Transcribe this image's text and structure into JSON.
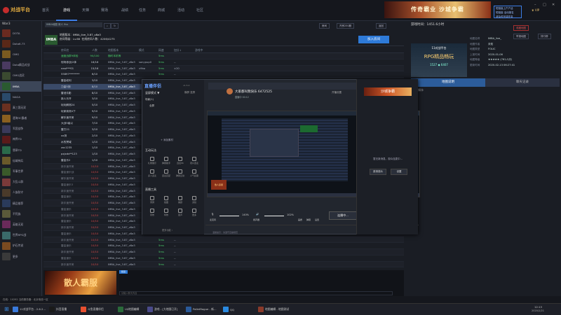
{
  "topnav": {
    "logo": "对战平台",
    "items": [
      "首页",
      "游戏",
      "天梯",
      "赛场",
      "战绩",
      "任务",
      "商城",
      "活动",
      "社区"
    ],
    "active_index": 1,
    "banner_text": "传奇霸业 沙城争霸",
    "notice_lines": [
      "短链接上户户活",
      "短链接 活动报名",
      "请及时完成任务"
    ],
    "vip_label": "VIP"
  },
  "leftbar": {
    "title": "War3",
    "items": [
      {
        "label": "DOTA",
        "color": "#6a2a20"
      },
      {
        "label": "Dota6.73",
        "color": "#5a2818"
      },
      {
        "label": "OMG",
        "color": "#7a5a20"
      },
      {
        "label": "Dota精品对战",
        "color": "#4a3a60"
      },
      {
        "label": "OMG战灵",
        "color": "#3a4a30"
      },
      {
        "label": "IMBA",
        "color": "#2a5a30"
      },
      {
        "label": "NAGA",
        "color": "#2a4a6a"
      },
      {
        "label": "真三国无双",
        "color": "#6a3020"
      },
      {
        "label": "澄海3C霸者",
        "color": "#8a6020"
      },
      {
        "label": "军团战争",
        "color": "#3a3a5a"
      },
      {
        "label": "神界TD",
        "color": "#5a1a1a"
      },
      {
        "label": "翡翠TD",
        "color": "#2a6a4a"
      },
      {
        "label": "仙域神兵",
        "color": "#6a5a2a"
      },
      {
        "label": "军事世界",
        "color": "#3a5a2a"
      },
      {
        "label": "大乱斗群",
        "color": "#7a3a3a"
      },
      {
        "label": "人族防守",
        "color": "#4a3a2a"
      },
      {
        "label": "精品推荐",
        "color": "#2a3a5a"
      },
      {
        "label": "不死族",
        "color": "#5a5a3a"
      },
      {
        "label": "英雄无双",
        "color": "#6a2a5a"
      },
      {
        "label": "世界RPG战",
        "color": "#3a6a6a"
      },
      {
        "label": "炉石传说",
        "color": "#7a4a20"
      },
      {
        "label": "更多",
        "color": "#3a3a3a"
      }
    ],
    "selected_index": 5
  },
  "roomhead": {
    "search_text": "IMBA地图  房人 9vs",
    "badge": "IMBA",
    "map_label": "地图版本：",
    "map_value": "IMBA_live_3.87_v8a3",
    "level_label": "房间等级：Lv.68",
    "player_label": "在线房间人数：4206/4275",
    "btn_filter": "房间",
    "btn_create": "开房250服",
    "btn_return": "返回",
    "join_label": "加入房间"
  },
  "table": {
    "headers": [
      "房间名",
      "人数",
      "地图版本",
      "模式",
      "网速",
      "加分↓",
      "游戏中"
    ],
    "rows": [
      [
        "速度战群9体验",
        "90/100",
        "随时本机等",
        "",
        "5ms",
        "",
        ""
      ],
      [
        "现场参战/2体",
        "16/16",
        "IMBA_live_3.87_v8a3",
        "sonypup0",
        "5ms",
        "--",
        ""
      ],
      [
        "neol***01",
        "15/16",
        "IMBA_live_3.87_v8a3",
        "v9bo",
        "5ms",
        "±20",
        ""
      ],
      [
        "55897********",
        "6/10",
        "IMBA_live_3.87_v8a3",
        "",
        "5ms",
        "--",
        ""
      ],
      [
        "雷金权利",
        "3/10",
        "IMBA_live_3.87_v8a3",
        "",
        "5ms",
        "--",
        ""
      ],
      [
        "力量5测",
        "8/10",
        "IMBA_live_3.87_v8a3",
        "",
        "5ms",
        "--",
        ""
      ],
      [
        "雷池玲影",
        "8/10",
        "IMBA_live_3.87_v8a3",
        "",
        "5ms",
        "--",
        ""
      ],
      [
        "新人乐开",
        "3/10",
        "IMBA_live_3.87_v8a3",
        "",
        "5ms",
        "--",
        ""
      ],
      [
        "玩玩解测24",
        "5/10",
        "IMBA_live_3.87_v8a3",
        "",
        "5ms",
        "--",
        ""
      ],
      [
        "玩家我测4下",
        "9/10",
        "IMBA_live_3.87_v8a3",
        "",
        "5ms",
        "--",
        ""
      ],
      [
        "解手速开房",
        "9/10",
        "IMBA_live_3.87_v8a3",
        "",
        "5ms",
        "--",
        ""
      ],
      [
        "大战5级以",
        "7/10",
        "IMBA_live_3.87_v8a3",
        "",
        "5ms",
        "--",
        ""
      ],
      [
        "雷方21",
        "3/10",
        "IMBA_live_3.87_v8a3",
        "",
        "5ms",
        "--",
        ""
      ],
      [
        "xx测",
        "2/10",
        "IMBA_live_3.87_v8a3",
        "",
        "5ms",
        "--",
        ""
      ],
      [
        "水的冥域",
        "1/10",
        "IMBA_live_3.87_v8a3",
        "",
        "5ms",
        "--",
        ""
      ],
      [
        "zxc1235",
        "1/10",
        "IMBA_live_3.87_v8a3",
        "",
        "5ms",
        "--",
        ""
      ],
      [
        "pxjxds**123",
        "1/10",
        "IMBA_live_3.87_v8a3",
        "",
        "5ms",
        "--",
        ""
      ],
      [
        "雷金乐2",
        "1/10",
        "IMBA_live_3.87_v8a3",
        "",
        "5ms",
        "--",
        ""
      ],
      [
        "新手速开房",
        "10/10",
        "IMBA_live_3.87_v8a3",
        "",
        "5ms",
        "--",
        ""
      ],
      [
        "雷金速乐战",
        "10/10",
        "IMBA_live_3.87_v8a3",
        "",
        "5ms",
        "--",
        ""
      ],
      [
        "解手速开房",
        "10/10",
        "IMBA_live_3.87_v8a3",
        "",
        "5ms",
        "--",
        ""
      ],
      [
        "雷金速乐3",
        "10/10",
        "IMBA_live_3.87_v8a3",
        "",
        "5ms",
        "--",
        ""
      ],
      [
        "新手速开房",
        "10/10",
        "IMBA_live_3.87_v8a3",
        "",
        "5ms",
        "--",
        ""
      ],
      [
        "雷金速乐",
        "10/10",
        "IMBA_live_3.87_v8a3",
        "",
        "5ms",
        "--",
        ""
      ],
      [
        "新手速开房",
        "10/10",
        "IMBA_live_3.87_v8a3",
        "",
        "5ms",
        "--",
        ""
      ],
      [
        "雷金速乐",
        "10/10",
        "IMBA_live_3.87_v8a3",
        "",
        "5ms",
        "--",
        ""
      ],
      [
        "新手速开房",
        "10/10",
        "IMBA_live_3.87_v8a3",
        "",
        "5ms",
        "--",
        ""
      ],
      [
        "雷金速乐",
        "10/10",
        "IMBA_live_3.87_v8a3",
        "",
        "5ms",
        "--",
        ""
      ],
      [
        "新手速开房",
        "10/10",
        "IMBA_live_3.87_v8a3",
        "",
        "5ms",
        "--",
        ""
      ],
      [
        "雷金速乐",
        "10/10",
        "IMBA_live_3.87_v8a3",
        "",
        "5ms",
        "--",
        ""
      ],
      [
        "新手速开房",
        "10/10",
        "IMBA_live_3.87_v8a3",
        "",
        "5ms",
        "--",
        ""
      ],
      [
        "雷金速乐",
        "10/10",
        "IMBA_live_3.87_v8a3",
        "",
        "5ms",
        "--",
        ""
      ],
      [
        "新手速开房",
        "10/10",
        "IMBA_live_3.87_v8a3",
        "",
        "5ms",
        "--",
        ""
      ],
      [
        "雷金速乐",
        "10/10",
        "IMBA_live_3.87_v8a3",
        "",
        "5ms",
        "--",
        ""
      ],
      [
        "新手速开房",
        "10/10",
        "IMBA_live_3.87_v8a3",
        "",
        "5ms",
        "--",
        ""
      ]
    ],
    "selected_index": 5
  },
  "bottompanel": {
    "ad_text": "散人霸服",
    "chat_tab": "频道",
    "input_placeholder": "请输入聊天内容"
  },
  "rightpanel": {
    "header": "游戏时间：1451.6小时",
    "ad_top": "11对战平台",
    "ad_main": "RPG精品畅玩",
    "ad_stats": "1527  ◆ 6407",
    "info": [
      {
        "k": "地图名称",
        "v": "IMBA_live_"
      },
      {
        "k": "地图作者",
        "v": "未知"
      },
      {
        "k": "地图类型",
        "v": "FOLIC"
      },
      {
        "k": "上架时间",
        "v": "2020-01-06"
      },
      {
        "k": "地图等级",
        "v": "★★★★★ (761人评)"
      },
      {
        "k": "更新时间",
        "v": "2020-02-13 06:27:41"
      }
    ],
    "btn_fav": "收藏地图",
    "btn_report": "举报地图",
    "btn_rank": "排行榜",
    "tabs": [
      "地图说明",
      "聊天记录"
    ],
    "active_tab": 0,
    "notice": "通知卡"
  },
  "stream": {
    "logo": "直播伴侣",
    "version": "v1.5.4",
    "mode_label": "竖屏模式 ▼",
    "mode_right": "横屏  竖屏",
    "scene_label": "场景(1)",
    "scene_item": "全屏",
    "add_label": "+ 添加素材",
    "sect1": "互动玩法",
    "sect1_items": [
      "礼物展示",
      "弹幕助手",
      "连麦PK",
      "观众连麦",
      "多人连麦",
      "连麦匹配",
      "弹幕互动",
      "人气投票"
    ],
    "sect2": "直播工具",
    "sect2_items": [
      "录屏",
      "截图",
      "美颜",
      "滤镜",
      "音效",
      "特效",
      "变声",
      "更多"
    ],
    "more_label": "更多功能 ›",
    "header_text": "大家都叫我快乐 6472525",
    "sub_text": "直播中  00:12",
    "hdr_icons": [
      "开播设置",
      "主播任务",
      "分享"
    ],
    "mic_label": "麦克风",
    "mic_value": "140%",
    "spk_label": "扬声器",
    "spk_value": "102%",
    "tool_labels": [
      "画质",
      "弹幕",
      "设置"
    ],
    "start_label": "连播中...",
    "note": "温馨提示：请遵守直播规范"
  },
  "sidepanel": {
    "ad": "沙城争霸",
    "msg": "暂无新消息，观众连麦中...",
    "btn1": "邀请观众",
    "btn2": "设置"
  },
  "statusbar": {
    "text": "在线：10292  当前服务器：北京电信一区"
  },
  "taskbar": {
    "items": [
      {
        "label": "11对战平台 - 2.6.2...",
        "color": "#3a7adc"
      },
      {
        "label": "抖音直播",
        "color": "#1a1a1a"
      },
      {
        "label": "斗鱼直播伴侣",
        "color": "#e85030"
      },
      {
        "label": "UI/地图编辑",
        "color": "#2a6a3a"
      },
      {
        "label": "游戏 - [大地图已开]",
        "color": "#4a4a8a"
      },
      {
        "label": "PalletRogue - 新...",
        "color": "#2a5a9a"
      },
      {
        "label": "QQ",
        "color": "#2a8ae0"
      },
      {
        "label": "地图编辑 - 地图测试",
        "color": "#8a3a2a"
      }
    ],
    "clock": "12:13",
    "date": "2020/2/21"
  }
}
